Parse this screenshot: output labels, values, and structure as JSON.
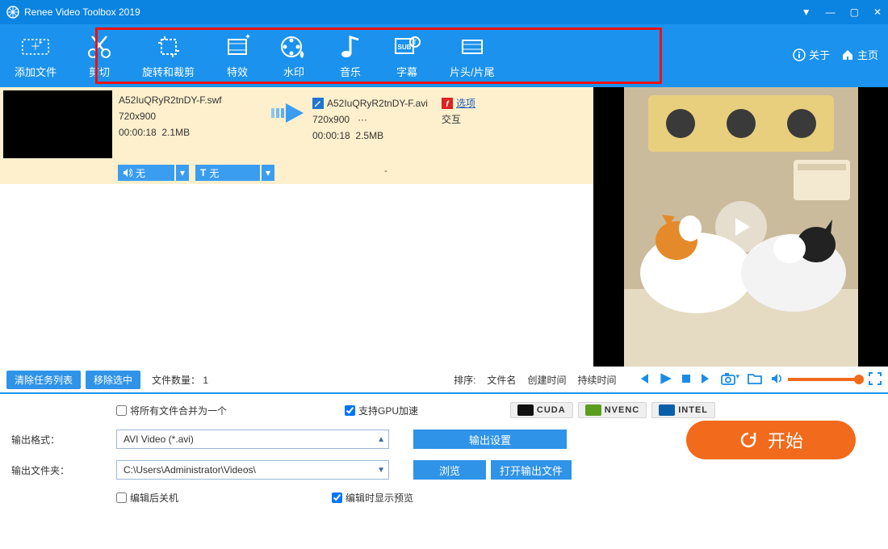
{
  "title": "Renee Video Toolbox 2019",
  "toolbar": {
    "add_file": "添加文件",
    "cut": "剪切",
    "rotate_crop": "旋转和裁剪",
    "effects": "特效",
    "watermark": "水印",
    "music": "音乐",
    "subtitle": "字幕",
    "intro_outro": "片头/片尾",
    "about": "关于",
    "home": "主页"
  },
  "file": {
    "src_name": "A52IuQRyR2tnDY-F.swf",
    "src_dim": "720x900",
    "src_dur": "00:00:18",
    "src_size": "2.1MB",
    "dst_name": "A52IuQRyR2tnDY-F.avi",
    "dst_dim": "720x900",
    "dst_more": "···",
    "dst_dur": "00:00:18",
    "dst_size": "2.5MB",
    "options": "选项",
    "interactive": "交互",
    "audio_dd": "无",
    "text_dd": "无",
    "dash": "-"
  },
  "listbar": {
    "clear": "清除任务列表",
    "remove_sel": "移除选中",
    "count_label": "文件数量：",
    "count": "1",
    "sort_label": "排序:",
    "sort_name": "文件名",
    "sort_ctime": "创建时间",
    "sort_duration": "持续时间"
  },
  "options": {
    "merge_all": "将所有文件合并为一个",
    "gpu": "支持GPU加速",
    "out_format_label": "输出格式：",
    "out_format_value": "AVI Video (*.avi)",
    "out_settings": "输出设置",
    "out_folder_label": "输出文件夹：",
    "out_folder_value": "C:\\Users\\Administrator\\Videos\\",
    "browse": "浏览",
    "open_out": "打开输出文件",
    "shutdown_after": "编辑后关机",
    "preview_while_edit": "编辑时显示预览",
    "start": "开始"
  },
  "badges": {
    "cuda": "CUDA",
    "nvenc": "NVENC",
    "intel": "INTEL"
  }
}
